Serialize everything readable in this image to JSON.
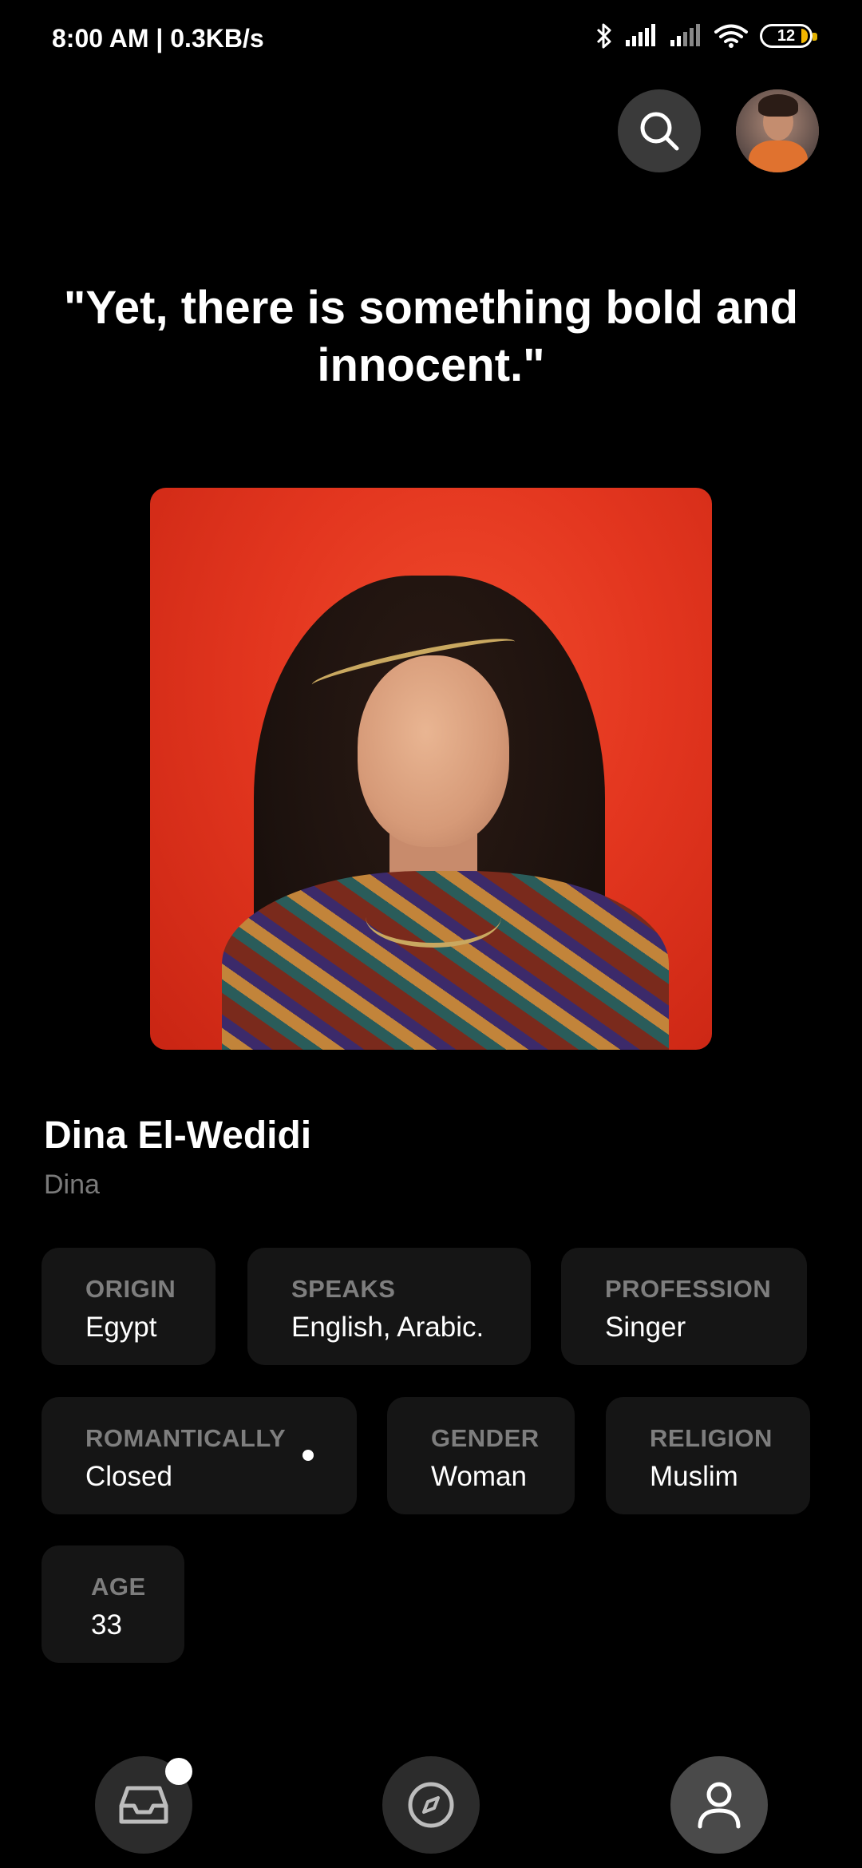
{
  "status_bar": {
    "time": "8:00 AM | 0.3KB/s",
    "battery": "12",
    "icons": [
      "bluetooth-icon",
      "signal-icon",
      "signal-icon",
      "wifi-icon",
      "battery-icon"
    ]
  },
  "header": {
    "search_icon": "search-icon",
    "avatar": "user-avatar"
  },
  "quote": "\"Yet, there is something bold and innocent.\"",
  "profile": {
    "name": "Dina El-Wedidi",
    "nickname": "Dina",
    "attributes": [
      {
        "label": "ORIGIN",
        "value": "Egypt"
      },
      {
        "label": "SPEAKS",
        "value": "English, Arabic."
      },
      {
        "label": "PROFESSION",
        "value": "Singer"
      },
      {
        "label": "ROMANTICALLY",
        "value": "Closed"
      },
      {
        "label": "GENDER",
        "value": "Woman"
      },
      {
        "label": "RELIGION",
        "value": "Muslim"
      },
      {
        "label": "AGE",
        "value": "33"
      }
    ]
  },
  "bottom_nav": {
    "items": [
      {
        "name": "inbox",
        "icon": "inbox-icon",
        "has_badge": true
      },
      {
        "name": "explore",
        "icon": "compass-icon"
      },
      {
        "name": "profile",
        "icon": "user-icon",
        "active": true
      }
    ]
  },
  "colors": {
    "background": "#000000",
    "chip": "#151515",
    "label": "#7e7e7e",
    "nav_button": "#2c2c2c",
    "nav_button_active": "#4a4a4a"
  }
}
